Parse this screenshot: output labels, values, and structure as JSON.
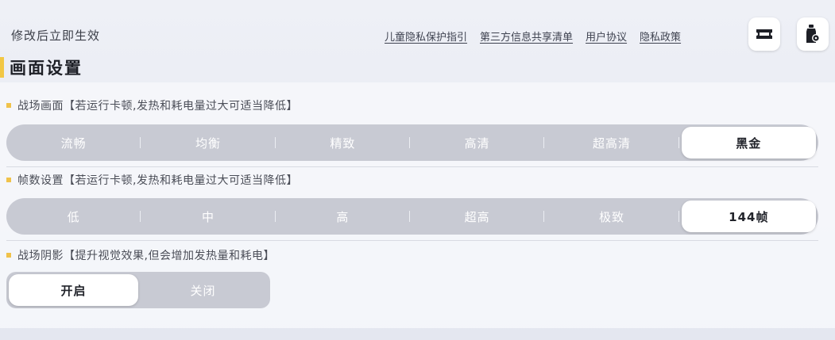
{
  "header": {
    "notice": "修改后立即生效",
    "links": [
      "儿童隐私保护指引",
      "第三方信息共享清单",
      "用户协议",
      "隐私政策"
    ],
    "icons": [
      "ticket-icon",
      "bottle-settings-icon"
    ]
  },
  "section": {
    "title": "画面设置"
  },
  "settings": {
    "battle_quality": {
      "label": "战场画面【若运行卡顿,发热和耗电量过大可适当降低】",
      "options": [
        "流畅",
        "均衡",
        "精致",
        "高清",
        "超高清",
        "黑金"
      ],
      "selected": "黑金"
    },
    "frame_rate": {
      "label": "帧数设置【若运行卡顿,发热和耗电量过大可适当降低】",
      "options": [
        "低",
        "中",
        "高",
        "超高",
        "极致",
        "144帧"
      ],
      "selected": "144帧"
    },
    "shadow": {
      "label": "战场阴影【提升视觉效果,但会增加发热量和耗电】",
      "options": [
        "开启",
        "关闭"
      ],
      "selected": "开启"
    }
  },
  "colors": {
    "accent": "#f2c744",
    "track": "#c8cad3",
    "active": "#ffffff"
  }
}
